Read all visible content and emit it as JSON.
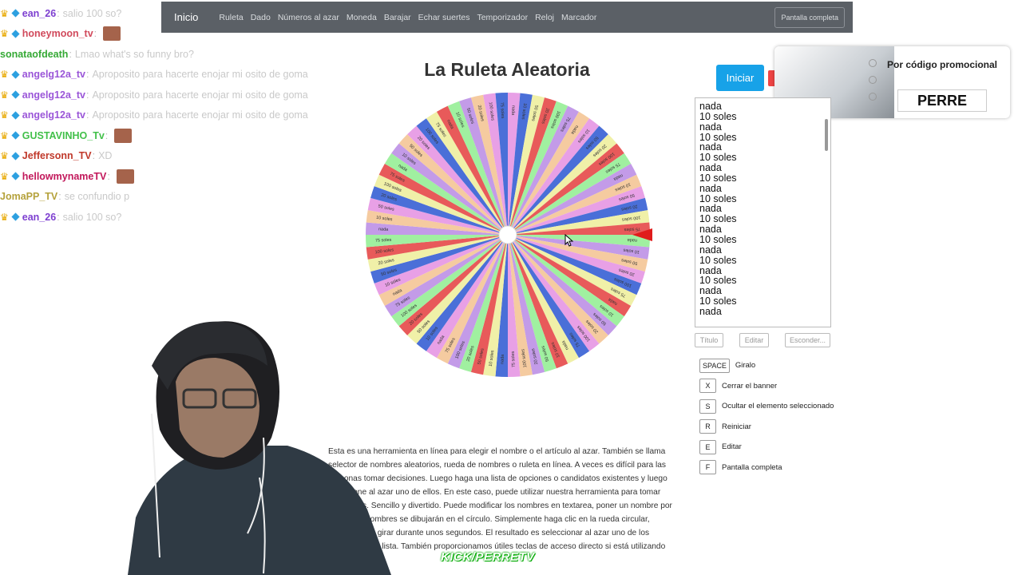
{
  "navbar": {
    "brand": "Inicio",
    "links": [
      "Ruleta",
      "Dado",
      "Números al azar",
      "Moneda",
      "Barajar",
      "Echar suertes",
      "Temporizador",
      "Reloj",
      "Marcador"
    ],
    "fullscreen": "Pantalla completa"
  },
  "chat": [
    {
      "name": "ean_26",
      "color": "#7d3fd0",
      "text": "salio 100 so?",
      "crown": true,
      "emote": false
    },
    {
      "name": "honeymoon_tv",
      "color": "#d14a5c",
      "text": "",
      "crown": true,
      "emote": true
    },
    {
      "name": "sonataofdeath",
      "color": "#35a935",
      "text": "Lmao what's so funny bro?",
      "crown": false,
      "emote": false
    },
    {
      "name": "angelg12a_tv",
      "color": "#9a55d8",
      "text": "Aproposito para hacerte enojar mi osito de goma",
      "crown": true,
      "emote": false
    },
    {
      "name": "angelg12a_tv",
      "color": "#9a55d8",
      "text": "Aproposito para hacerte enojar mi osito de goma",
      "crown": true,
      "emote": false
    },
    {
      "name": "angelg12a_tv",
      "color": "#9a55d8",
      "text": "Aproposito para hacerte enojar mi osito de goma",
      "crown": true,
      "emote": false
    },
    {
      "name": "GUSTAVINHO_Tv",
      "color": "#42c04a",
      "text": "",
      "crown": true,
      "emote": true
    },
    {
      "name": "Jeffersonn_TV",
      "color": "#c0392b",
      "text": "XD",
      "crown": true,
      "emote": false
    },
    {
      "name": "hellowmynameTV",
      "color": "#c2185b",
      "text": "",
      "crown": true,
      "emote": true
    },
    {
      "name": "JomaPP_TV",
      "color": "#b5a23c",
      "text": "se confundio p",
      "crown": false,
      "emote": false
    },
    {
      "name": "ean_26",
      "color": "#7d3fd0",
      "text": "salio 100 so?",
      "crown": true,
      "emote": false
    }
  ],
  "title": "La Ruleta Aleatoria",
  "start_button": "Iniciar",
  "ad": {
    "text": "Por código promocional",
    "code": "PERRE"
  },
  "options": [
    "nada",
    "10 soles",
    "nada",
    "10 soles",
    "nada",
    "10 soles",
    "nada",
    "10 soles",
    "nada",
    "10 soles",
    "nada",
    "10 soles",
    "nada",
    "10 soles",
    "nada",
    "10 soles",
    "nada",
    "10 soles",
    "nada",
    "10 soles",
    "nada"
  ],
  "buttons": {
    "title": "Título",
    "edit": "Editar",
    "hide": "Esconder..."
  },
  "shortcuts": [
    {
      "key": "SPACE",
      "label": "Giralo"
    },
    {
      "key": "X",
      "label": "Cerrar el banner"
    },
    {
      "key": "S",
      "label": "Ocultar el elemento seleccionado"
    },
    {
      "key": "R",
      "label": "Reiniciar"
    },
    {
      "key": "E",
      "label": "Editar"
    },
    {
      "key": "F",
      "label": "Pantalla completa"
    }
  ],
  "description": "Esta es una herramienta en línea para elegir el nombre o el artículo al azar. También se llama selector de nombres aleatorios, rueda de nombres o ruleta en línea. A veces es difícil para las personas tomar decisiones. Luego haga una lista de opciones o candidatos existentes y luego seleccione al azar uno de ellos. En este caso, puede utilizar nuestra herramienta para tomar decisiones. Sencillo y divertido. Puede modificar los nombres en textarea, poner un nombre por línea. Los nombres se dibujarán en el círculo. Simplemente haga clic en la rueda circular, comenzará a girar durante unos segundos. El resultado es seleccionar al azar uno de los nombres de la lista. También proporcionamos útiles teclas de acceso directo si está utilizando",
  "wheel": {
    "colors": [
      "#e8a0e6",
      "#4a6fd8",
      "#f0f0a8",
      "#e85a5a",
      "#a0f0a0",
      "#c39be8",
      "#f5cba0"
    ],
    "labels": [
      "nada",
      "10 soles",
      "50 soles",
      "20 soles",
      "100 soles",
      "75 soles"
    ]
  },
  "watermark": "KICK/PERRETV"
}
